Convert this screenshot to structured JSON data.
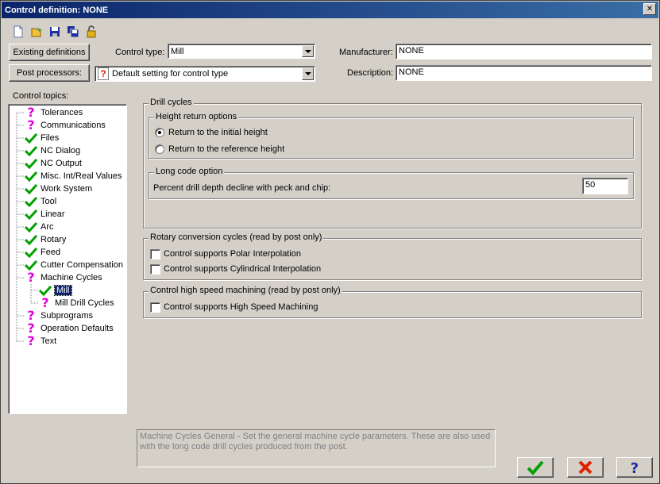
{
  "window": {
    "title": "Control definition: NONE",
    "close_glyph": "✕"
  },
  "toolbar": {
    "icons": [
      "new-file-icon",
      "open-file-icon",
      "save-icon",
      "save-all-icon",
      "lock-icon"
    ]
  },
  "header": {
    "existing_definitions_label": "Existing definitions",
    "post_processors_label": "Post processors:",
    "control_type_label": "Control type:",
    "control_type_value": "Mill",
    "post_processor_value": "Default setting for control type",
    "manufacturer_label": "Manufacturer:",
    "manufacturer_value": "NONE",
    "description_label": "Description:",
    "description_value": "NONE"
  },
  "tree": {
    "label": "Control topics:",
    "items": [
      {
        "label": "Tolerances",
        "status": "question"
      },
      {
        "label": "Communications",
        "status": "question"
      },
      {
        "label": "Files",
        "status": "check"
      },
      {
        "label": "NC Dialog",
        "status": "check"
      },
      {
        "label": "NC Output",
        "status": "check"
      },
      {
        "label": "Misc. Int/Real Values",
        "status": "check"
      },
      {
        "label": "Work System",
        "status": "check"
      },
      {
        "label": "Tool",
        "status": "check"
      },
      {
        "label": "Linear",
        "status": "check"
      },
      {
        "label": "Arc",
        "status": "check"
      },
      {
        "label": "Rotary",
        "status": "check"
      },
      {
        "label": "Feed",
        "status": "check"
      },
      {
        "label": "Cutter Compensation",
        "status": "check"
      },
      {
        "label": "Machine Cycles",
        "status": "question"
      },
      {
        "label": "Mill",
        "status": "check"
      },
      {
        "label": "Mill Drill Cycles",
        "status": "question"
      },
      {
        "label": "Subprograms",
        "status": "question"
      },
      {
        "label": "Operation Defaults",
        "status": "question"
      },
      {
        "label": "Text",
        "status": "question"
      }
    ]
  },
  "drill_cycles": {
    "title": "Drill cycles",
    "height_return": {
      "title": "Height return options",
      "option_initial": "Return to the initial height",
      "option_reference": "Return to the reference height",
      "selected": "initial"
    },
    "long_code": {
      "title": "Long code option",
      "percent_label": "Percent drill depth decline with peck and chip:",
      "percent_value": "50"
    }
  },
  "rotary_conversion": {
    "title": "Rotary conversion cycles (read by post only)",
    "polar_label": "Control supports Polar Interpolation",
    "cylindrical_label": "Control supports Cylindrical Interpolation"
  },
  "high_speed": {
    "title": "Control high speed machining (read by post only)",
    "hsm_label": "Control supports High Speed Machining"
  },
  "help_text": "Machine Cycles General - Set the general machine cycle parameters.  These are also used with the long code drill cycles produced from the post.",
  "buttons": {
    "ok_icon": "check-icon",
    "cancel_icon": "x-icon",
    "help_icon": "question-icon"
  },
  "colors": {
    "title_bar": "#0a246a",
    "check_green": "#00a000",
    "question_magenta": "#e000e0",
    "cancel_red": "#e02000"
  }
}
